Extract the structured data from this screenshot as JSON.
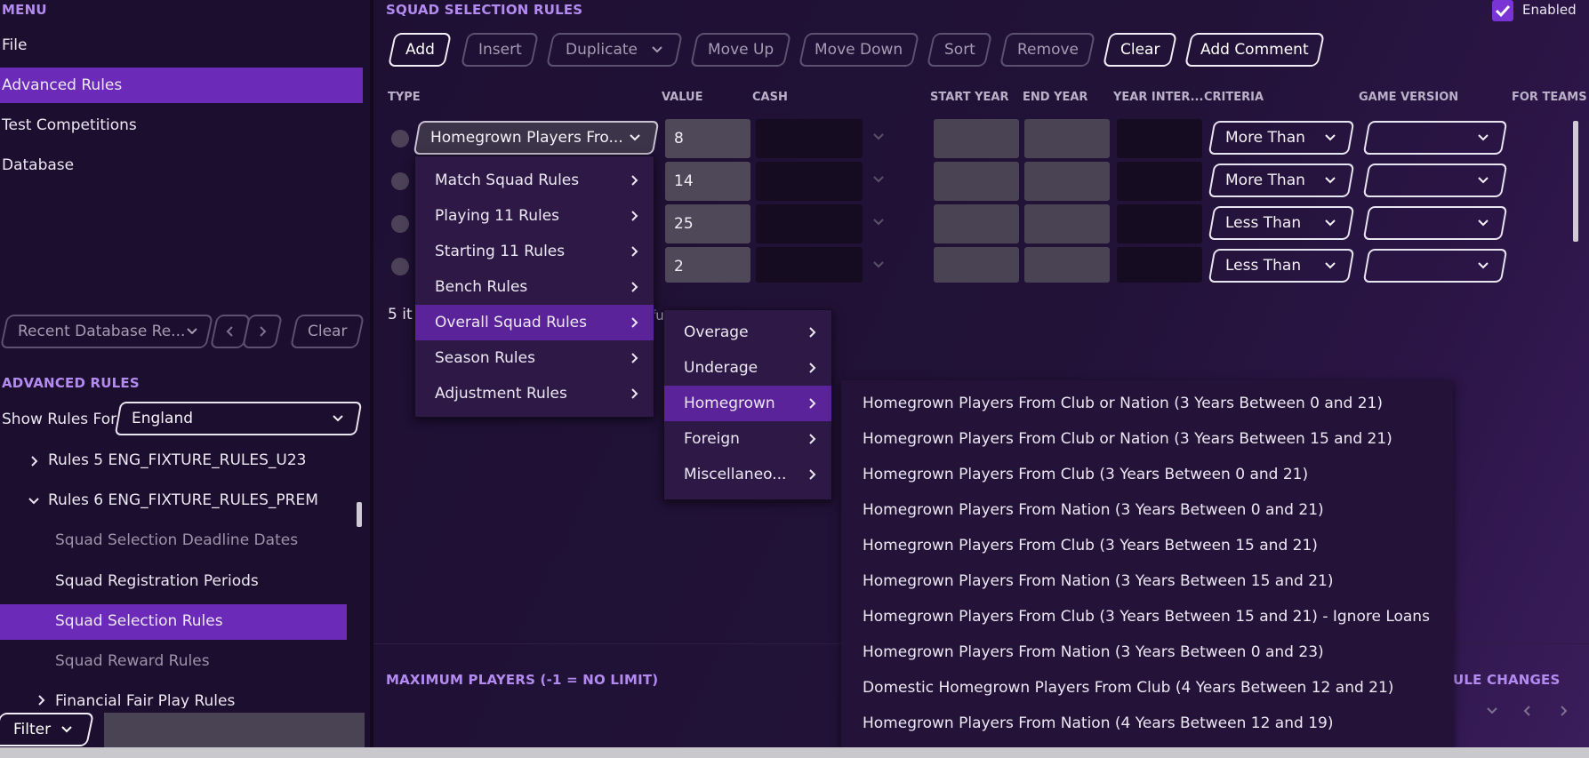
{
  "menu": {
    "title": "MENU",
    "items": [
      "File",
      "Advanced Rules",
      "Test Competitions",
      "Database"
    ]
  },
  "recent": {
    "placeholder": "Recent Database Re...",
    "clear": "Clear"
  },
  "advanced_rules": {
    "title": "ADVANCED RULES",
    "show_rules_for_label": "Show Rules For",
    "show_rules_for_value": "England",
    "tree": [
      "Rules 5 ENG_FIXTURE_RULES_U23",
      "Rules 6 ENG_FIXTURE_RULES_PREM",
      "Squad Selection Deadline Dates",
      "Squad Registration Periods",
      "Squad Selection Rules",
      "Squad Reward Rules",
      "Financial Fair Play Rules"
    ]
  },
  "filter": {
    "label": "Filter"
  },
  "squad": {
    "title": "SQUAD SELECTION RULES",
    "enabled_label": "Enabled",
    "toolbar": [
      "Add",
      "Insert",
      "Duplicate",
      "Move Up",
      "Move Down",
      "Sort",
      "Remove",
      "Clear",
      "Add Comment"
    ],
    "columns": [
      "TYPE",
      "VALUE",
      "CASH",
      "START YEAR",
      "END YEAR",
      "YEAR INTER...",
      "CRITERIA",
      "GAME VERSION",
      "FOR TEAMS"
    ],
    "rows": [
      {
        "type": "Homegrown Players Fro...",
        "value": "8",
        "criteria": "More Than"
      },
      {
        "type": "",
        "value": "14",
        "criteria": "More Than"
      },
      {
        "type": "",
        "value": "25",
        "criteria": "Less Than"
      },
      {
        "type": "",
        "value": "2",
        "criteria": "Less Than"
      }
    ],
    "items_count_partial": "5 it",
    "items_tail_partial": "fu"
  },
  "max_players_title": "MAXIMUM PLAYERS (-1 = NO LIMIT)",
  "rule_changes_partial": "ULE CHANGES",
  "menu_level1": [
    "Match Squad Rules",
    "Playing 11 Rules",
    "Starting 11 Rules",
    "Bench Rules",
    "Overall Squad Rules",
    "Season Rules",
    "Adjustment Rules"
  ],
  "menu_level2": [
    "Overage",
    "Underage",
    "Homegrown",
    "Foreign",
    "Miscellaneo..."
  ],
  "menu_level3": [
    "Homegrown Players From Club or Nation (3 Years Between 0 and 21)",
    "Homegrown Players From Club or Nation (3 Years Between 15 and 21)",
    "Homegrown Players From Club (3 Years Between 0 and 21)",
    "Homegrown Players From Nation (3 Years Between 0 and 21)",
    "Homegrown Players From Club (3 Years Between 15 and 21)",
    "Homegrown Players From Nation (3 Years Between 15 and 21)",
    "Homegrown Players From Club (3 Years Between 15 and 21) - Ignore Loans",
    "Homegrown Players From Nation (3 Years Between 0 and 23)",
    "Domestic Homegrown Players From Club (4 Years Between 12 and 21)",
    "Homegrown Players From Nation (4 Years Between 12 and 19)"
  ],
  "colors": {
    "accent": "#6b2ab8",
    "heading": "#b38bf0",
    "background": "#1a0d2b"
  },
  "icons": [
    "chevron-down-icon",
    "chevron-right-icon",
    "chevron-left-icon",
    "check-icon",
    "expand-arrow-icon",
    "collapse-arrow-icon"
  ]
}
